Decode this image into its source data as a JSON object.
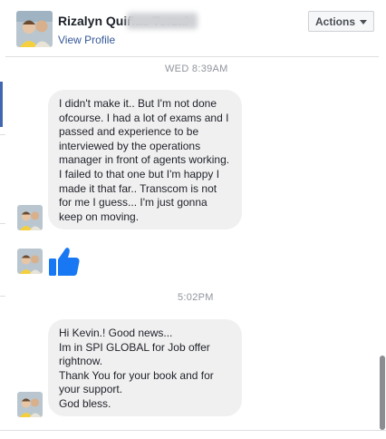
{
  "header": {
    "name": "Rizalyn Quiñas Terzal",
    "view_profile": "View Profile",
    "actions_label": "Actions"
  },
  "messages": {
    "timestamp_1": "WED 8:39AM",
    "bubble_1": "I didn't make it..  But I'm not done ofcourse.  I had a lot of exams and I passed and experience to be interviewed by the operations manager in front of agents working.  I failed to that one but I'm happy I made it that far..  Transcom is not for me I guess... I'm just gonna keep on moving.",
    "timestamp_2": "5:02PM",
    "bubble_2_lines": [
      "Hi Kevin.!  Good news...",
      "Im in SPI GLOBAL for Job offer rightnow.",
      "Thank You for your book and for your support.",
      "God bless."
    ]
  },
  "icons": {
    "like": "thumbs-up-icon",
    "actions_caret": "chevron-down-icon"
  },
  "colors": {
    "link": "#365899",
    "like_blue": "#1877f2",
    "bubble_bg": "#f1f0f0",
    "timestamp": "#90949c"
  }
}
